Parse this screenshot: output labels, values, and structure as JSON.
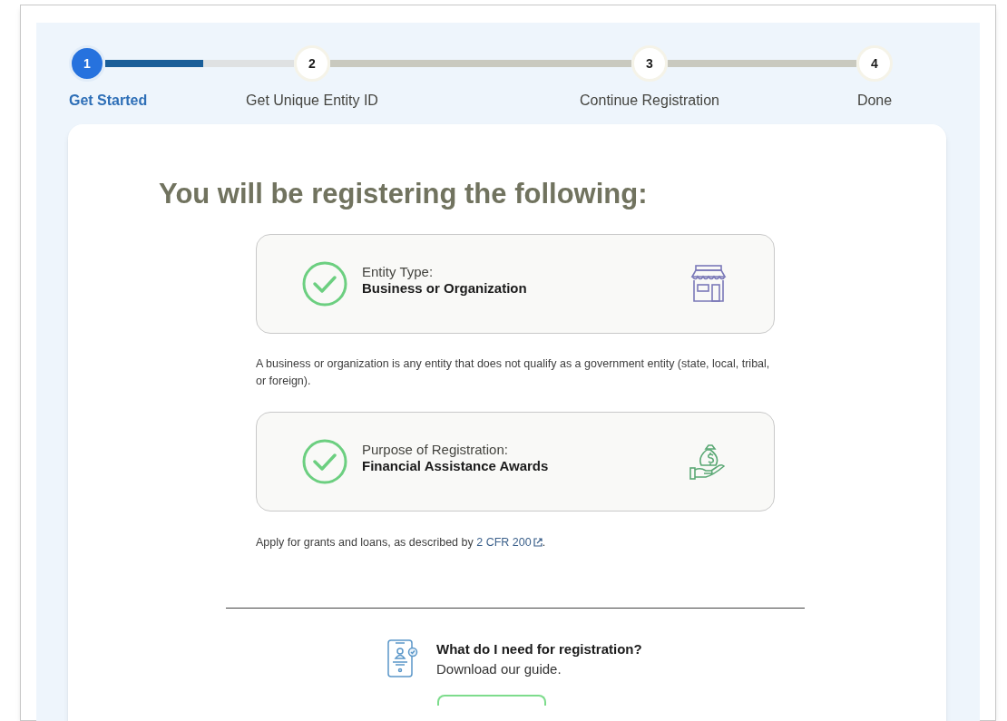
{
  "stepper": {
    "steps": [
      {
        "number": "1",
        "label": "Get Started",
        "selected": true
      },
      {
        "number": "2",
        "label": "Get Unique Entity ID",
        "selected": false
      },
      {
        "number": "3",
        "label": "Continue Registration",
        "selected": false
      },
      {
        "number": "4",
        "label": "Done",
        "selected": false
      }
    ],
    "connectors": [
      {
        "level": 0.52
      },
      {
        "level": 0
      },
      {
        "level": 0
      }
    ]
  },
  "heading": "You will be registering the following:",
  "selections": [
    {
      "label": "Entity Type:",
      "value": "Business or Organization",
      "checked": true,
      "kind": "storefront",
      "description": {
        "text": "A business or organization is any entity that does not qualify as a government entity (state, local, tribal, or foreign)."
      }
    },
    {
      "label": "Purpose of Registration:",
      "value": "Financial Assistance Awards",
      "checked": true,
      "kind": "money",
      "description": {
        "text": "Apply for grants and loans, as described by ",
        "link": "2 CFR 200",
        "after": "."
      }
    }
  ],
  "guide": {
    "title": "What do I need for registration?",
    "subtitle": "Download our guide."
  }
}
